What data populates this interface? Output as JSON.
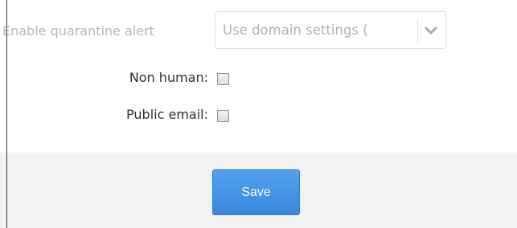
{
  "form": {
    "quarantine_alert": {
      "label": "Enable quarantine alert",
      "selected_value": "Use domain settings (",
      "arrow_icon": "chevron-down-icon"
    },
    "non_human": {
      "label": "Non human:",
      "checked": false
    },
    "public_email": {
      "label": "Public email:",
      "checked": false
    }
  },
  "footer": {
    "save_label": "Save"
  },
  "colors": {
    "label_muted": "#b6b6b6",
    "label_text": "#2f2f2f",
    "button_primary": "#3f8ee0",
    "footer_bg": "#f2f2f2"
  }
}
